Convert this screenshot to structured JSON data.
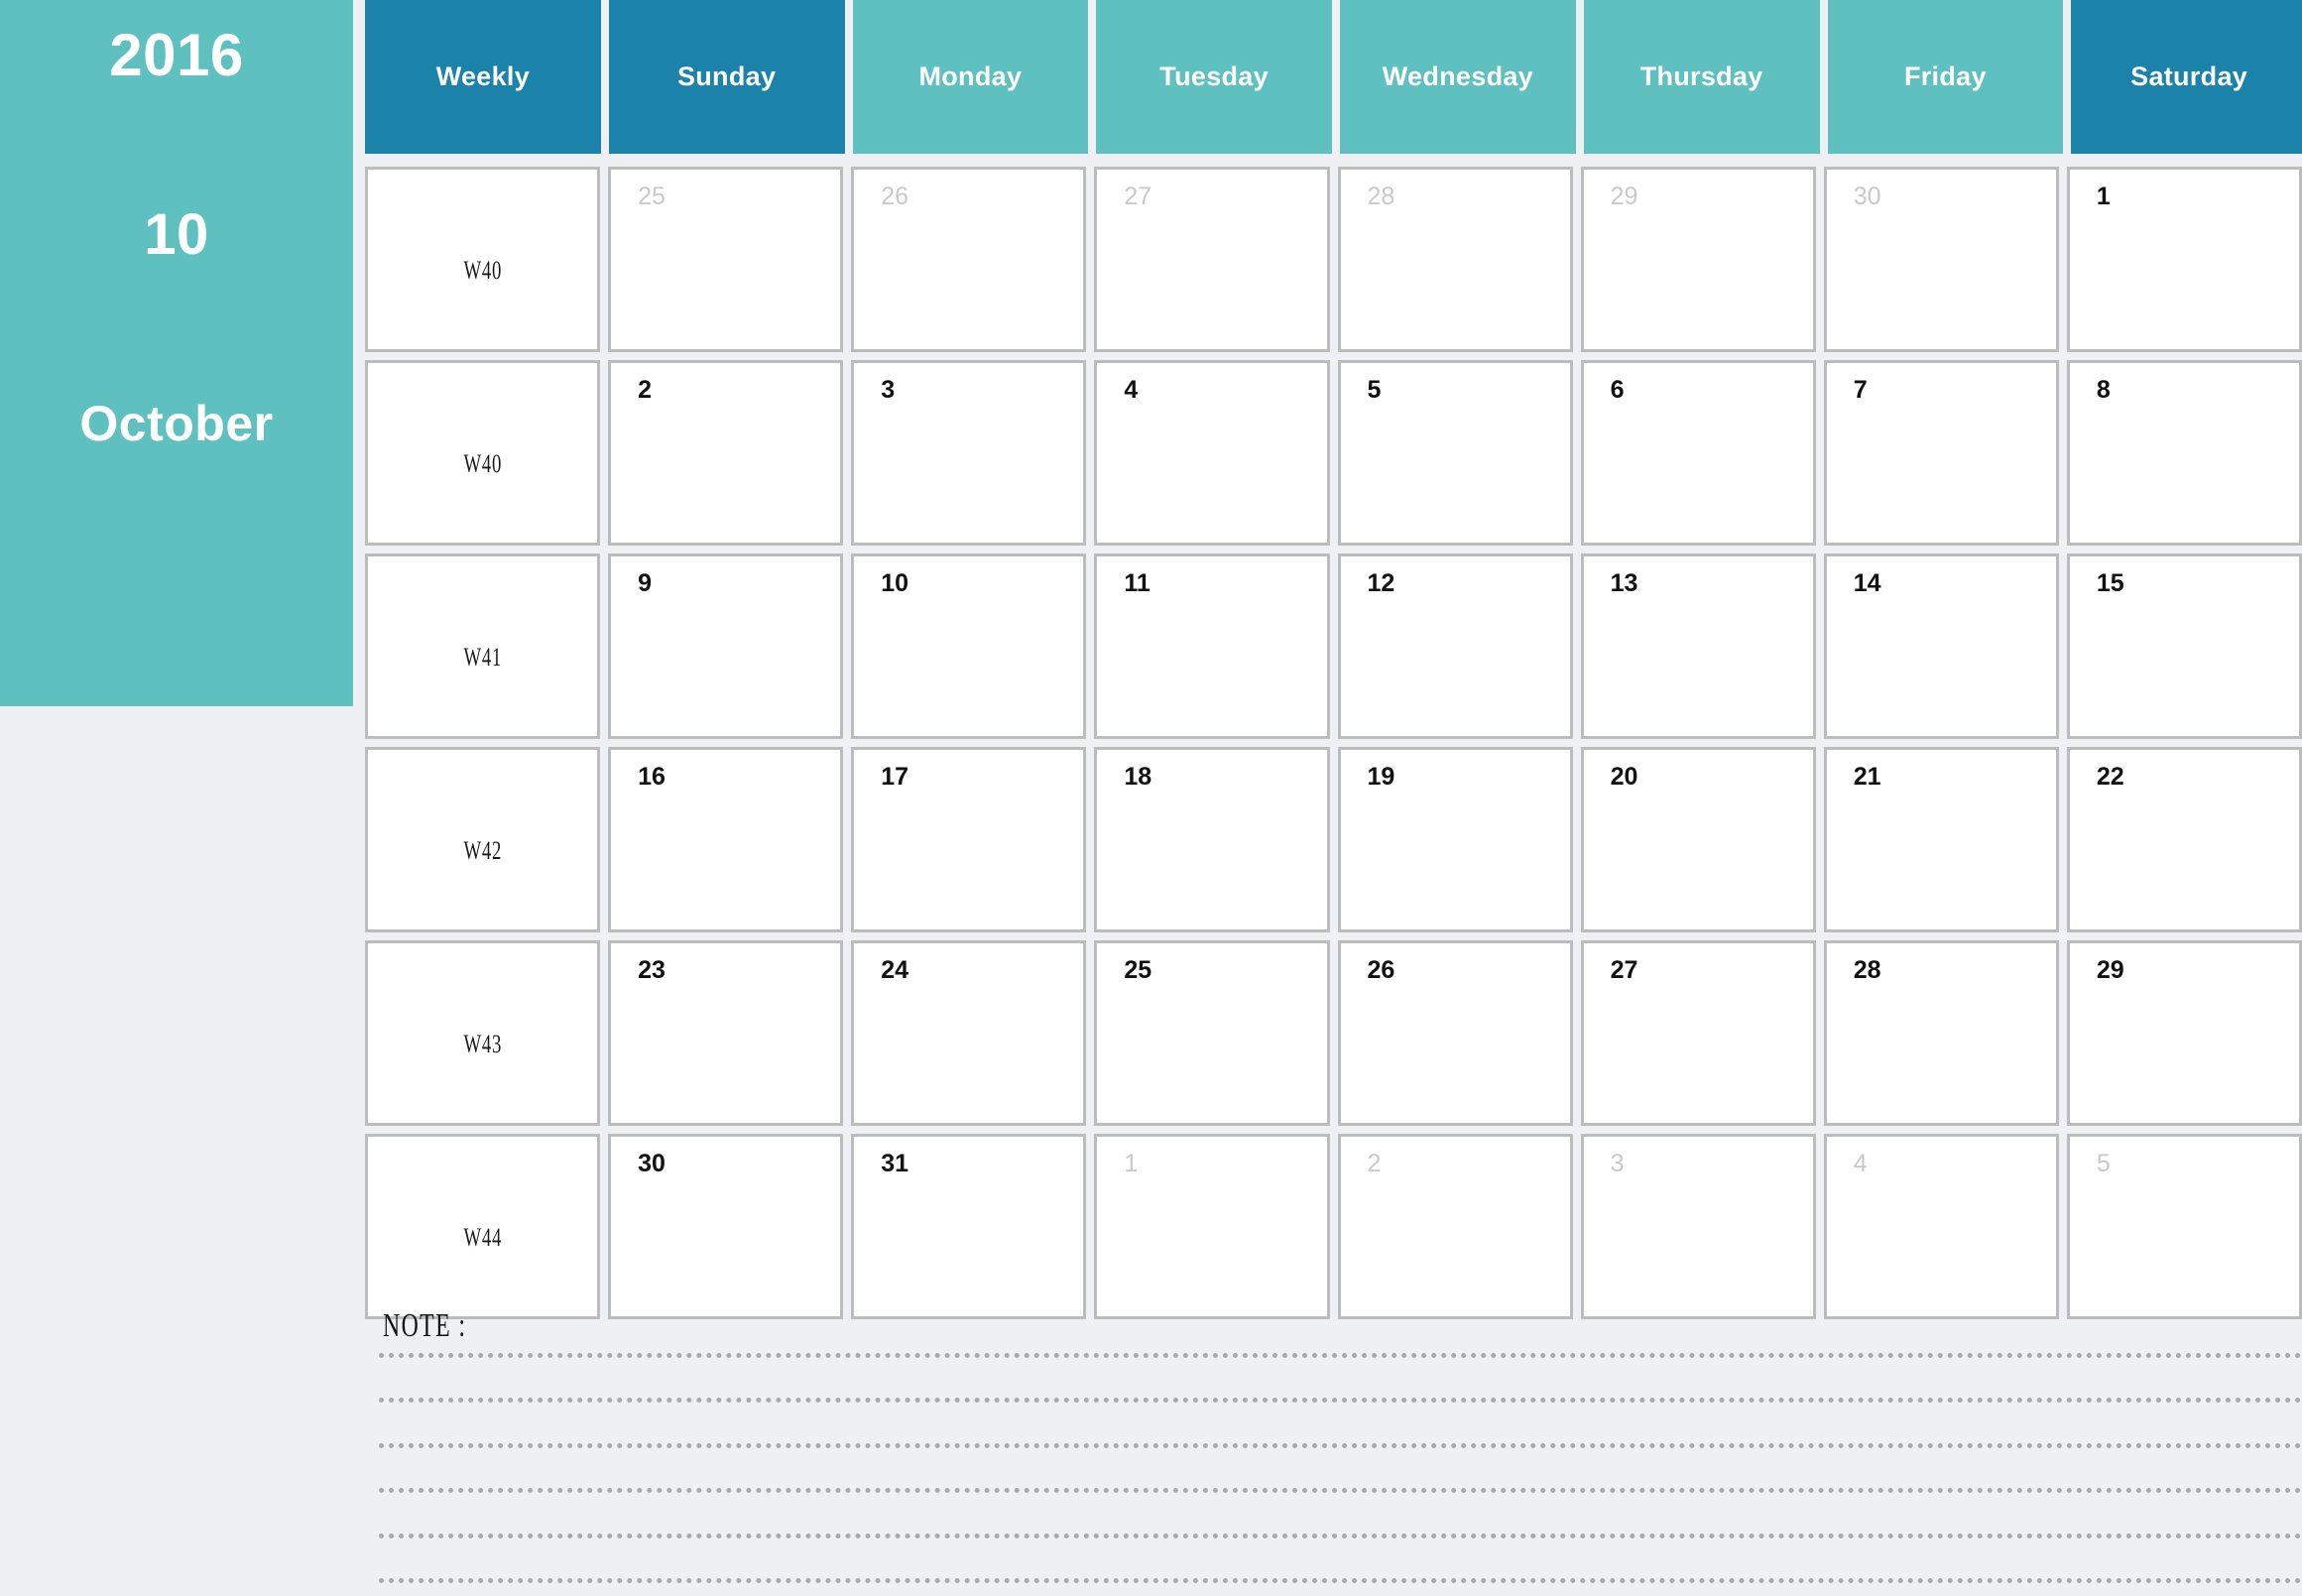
{
  "sidebar": {
    "year": "2016",
    "month_number": "10",
    "month_name": "October",
    "bg_color": "#5fc1bf",
    "text_color": "#ffffff"
  },
  "page": {
    "background_color": "#eff0f4",
    "accent_dark": "#1b83a9",
    "accent_light": "#5fc1bf",
    "cell_border_color": "#bcbcbc",
    "current_month_text_color": "#111111",
    "other_month_text_color": "#c9c9c9"
  },
  "header": {
    "columns": [
      {
        "label": "Weekly",
        "tone": "dark"
      },
      {
        "label": "Sunday",
        "tone": "dark"
      },
      {
        "label": "Monday",
        "tone": "light"
      },
      {
        "label": "Tuesday",
        "tone": "light"
      },
      {
        "label": "Wednesday",
        "tone": "light"
      },
      {
        "label": "Thursday",
        "tone": "light"
      },
      {
        "label": "Friday",
        "tone": "light"
      },
      {
        "label": "Saturday",
        "tone": "dark"
      }
    ]
  },
  "weeks": [
    {
      "week_label": "W40",
      "days": [
        {
          "num": "25",
          "current": false
        },
        {
          "num": "26",
          "current": false
        },
        {
          "num": "27",
          "current": false
        },
        {
          "num": "28",
          "current": false
        },
        {
          "num": "29",
          "current": false
        },
        {
          "num": "30",
          "current": false
        },
        {
          "num": "1",
          "current": true
        }
      ]
    },
    {
      "week_label": "W40",
      "days": [
        {
          "num": "2",
          "current": true
        },
        {
          "num": "3",
          "current": true
        },
        {
          "num": "4",
          "current": true
        },
        {
          "num": "5",
          "current": true
        },
        {
          "num": "6",
          "current": true
        },
        {
          "num": "7",
          "current": true
        },
        {
          "num": "8",
          "current": true
        }
      ]
    },
    {
      "week_label": "W41",
      "days": [
        {
          "num": "9",
          "current": true
        },
        {
          "num": "10",
          "current": true
        },
        {
          "num": "11",
          "current": true
        },
        {
          "num": "12",
          "current": true
        },
        {
          "num": "13",
          "current": true
        },
        {
          "num": "14",
          "current": true
        },
        {
          "num": "15",
          "current": true
        }
      ]
    },
    {
      "week_label": "W42",
      "days": [
        {
          "num": "16",
          "current": true
        },
        {
          "num": "17",
          "current": true
        },
        {
          "num": "18",
          "current": true
        },
        {
          "num": "19",
          "current": true
        },
        {
          "num": "20",
          "current": true
        },
        {
          "num": "21",
          "current": true
        },
        {
          "num": "22",
          "current": true
        }
      ]
    },
    {
      "week_label": "W43",
      "days": [
        {
          "num": "23",
          "current": true
        },
        {
          "num": "24",
          "current": true
        },
        {
          "num": "25",
          "current": true
        },
        {
          "num": "26",
          "current": true
        },
        {
          "num": "27",
          "current": true
        },
        {
          "num": "28",
          "current": true
        },
        {
          "num": "29",
          "current": true
        }
      ]
    },
    {
      "week_label": "W44",
      "days": [
        {
          "num": "30",
          "current": true
        },
        {
          "num": "31",
          "current": true
        },
        {
          "num": "1",
          "current": false
        },
        {
          "num": "2",
          "current": false
        },
        {
          "num": "3",
          "current": false
        },
        {
          "num": "4",
          "current": false
        },
        {
          "num": "5",
          "current": false
        }
      ]
    }
  ],
  "note": {
    "label": "NOTE :",
    "line_count": 6
  }
}
